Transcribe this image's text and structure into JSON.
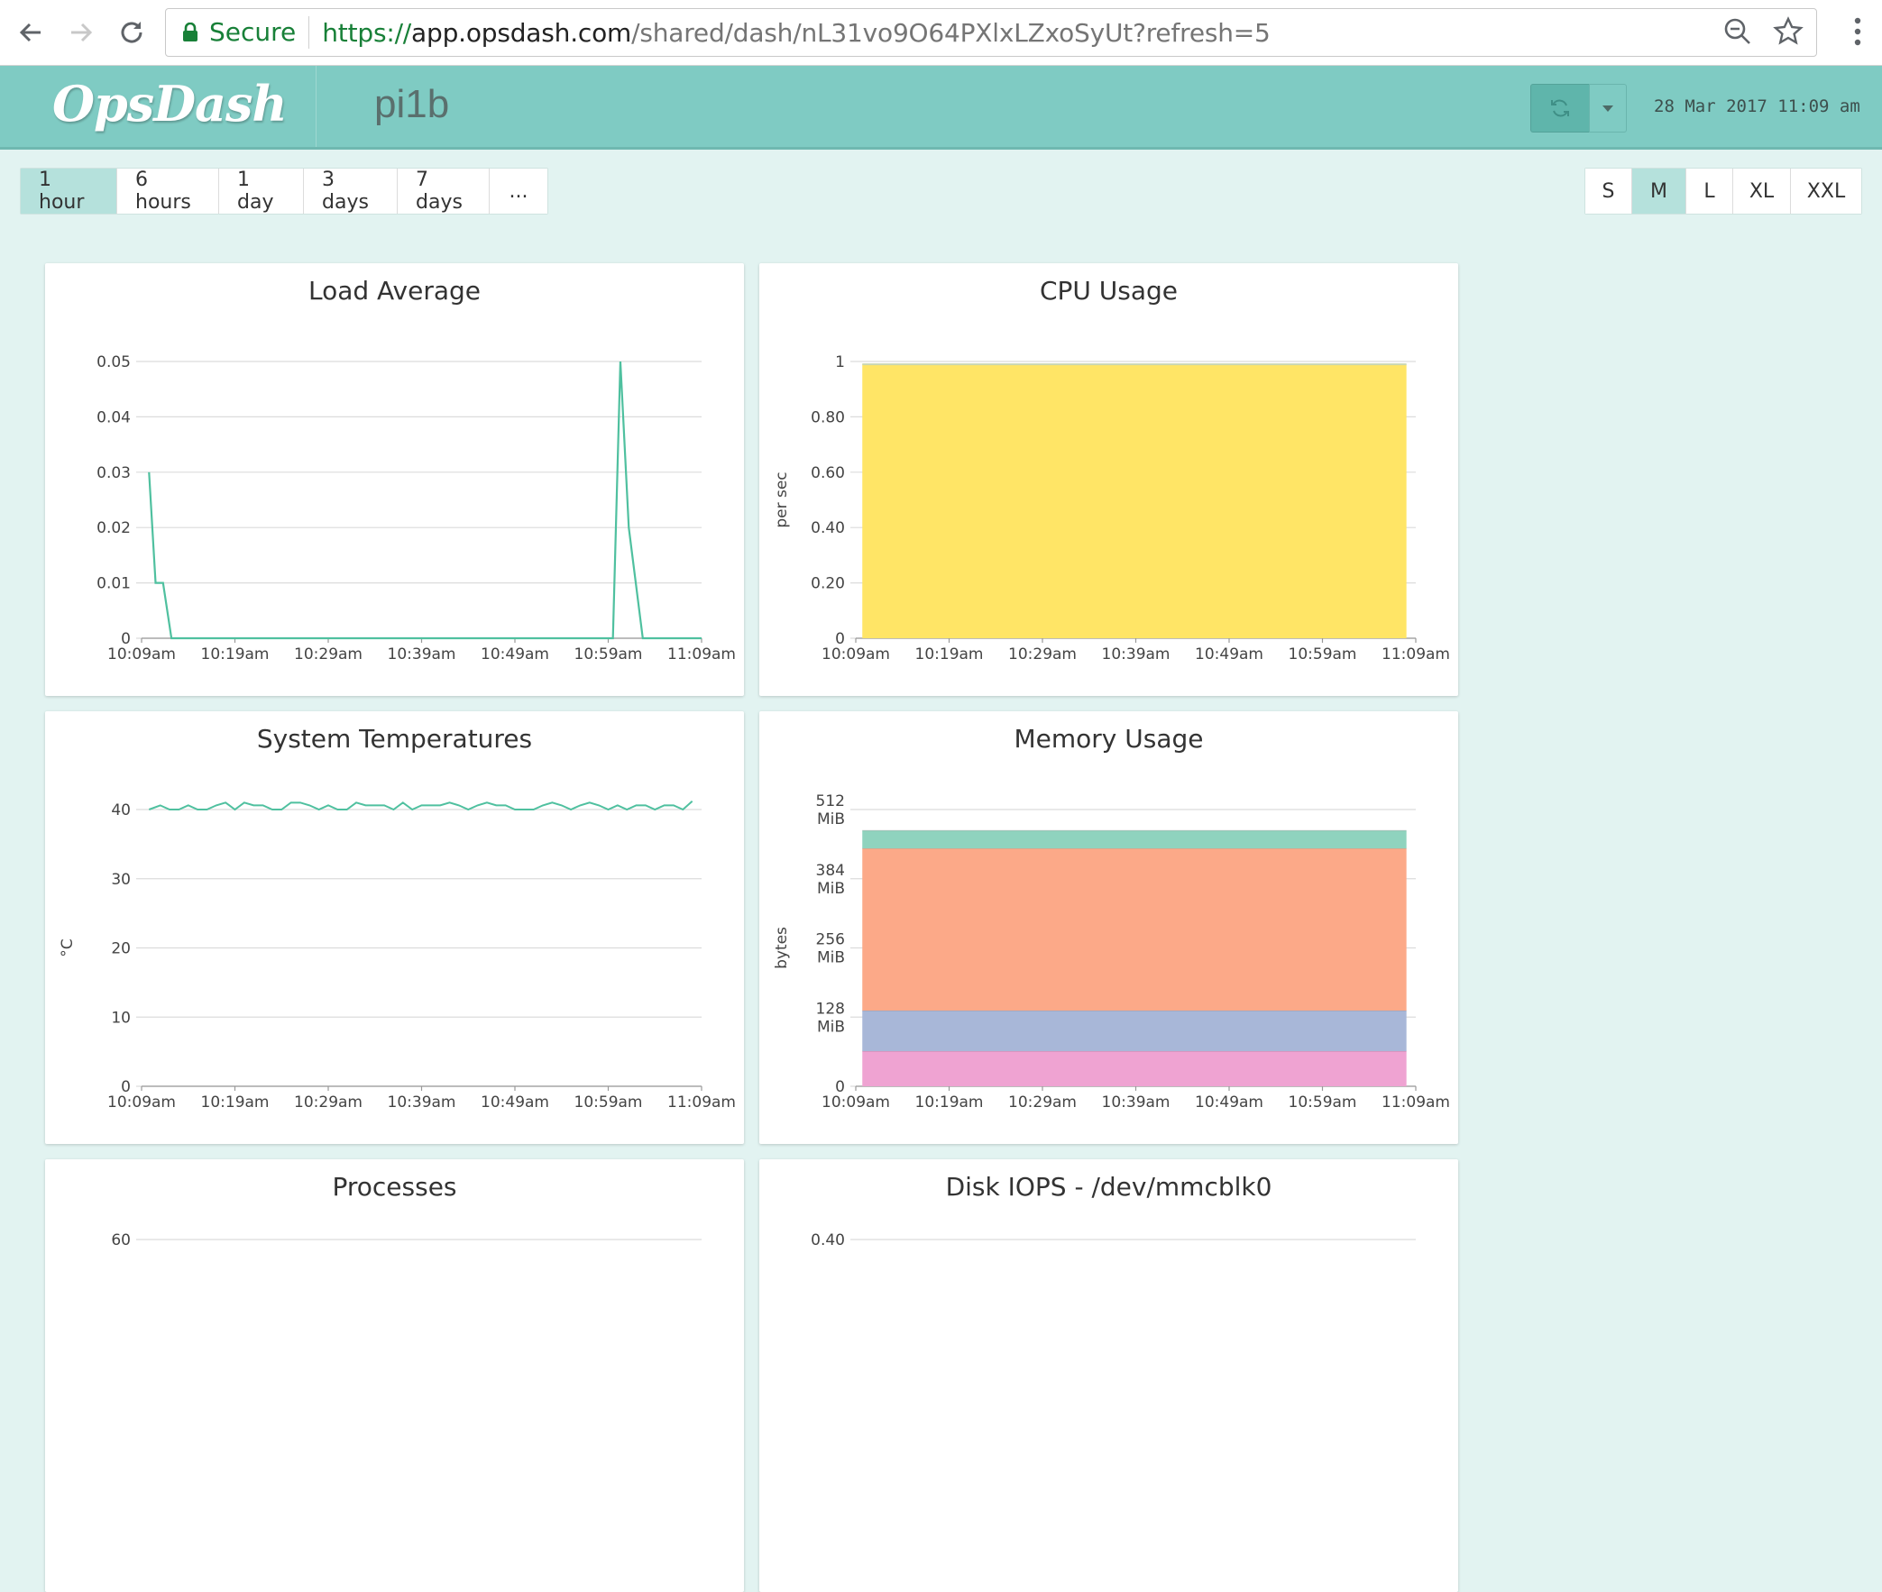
{
  "browser": {
    "secure_label": "Secure",
    "url_scheme": "https://",
    "url_host": "app.opsdash.com",
    "url_path": "/shared/dash/nL31vo9O64PXlxLZxoSyUt?refresh=5"
  },
  "header": {
    "logo": "OpsDash",
    "dashboard_name": "pi1b",
    "timestamp": "28 Mar 2017 11:09 am"
  },
  "time_ranges": [
    {
      "label": "1 hour",
      "active": true
    },
    {
      "label": "6 hours",
      "active": false
    },
    {
      "label": "1 day",
      "active": false
    },
    {
      "label": "3 days",
      "active": false
    },
    {
      "label": "7 days",
      "active": false
    },
    {
      "label": "...",
      "active": false
    }
  ],
  "sizes": [
    {
      "label": "S",
      "active": false
    },
    {
      "label": "M",
      "active": true
    },
    {
      "label": "L",
      "active": false
    },
    {
      "label": "XL",
      "active": false
    },
    {
      "label": "XXL",
      "active": false
    }
  ],
  "panels": {
    "load": {
      "title": "Load Average"
    },
    "cpu": {
      "title": "CPU Usage"
    },
    "temp": {
      "title": "System Temperatures"
    },
    "mem": {
      "title": "Memory Usage"
    },
    "proc": {
      "title": "Processes"
    },
    "disk": {
      "title": "Disk IOPS - /dev/mmcblk0"
    }
  },
  "colors": {
    "accent": "#7fcbc3",
    "line": "#4fc09f",
    "cpu_fill": "#ffe566",
    "mem_top": "#8fd3be",
    "mem_orange": "#fca988",
    "mem_blue": "#a8b7d8",
    "mem_pink": "#efa3d2"
  },
  "chart_data": [
    {
      "type": "line",
      "title": "Load Average",
      "ylabel": "",
      "x_ticks": [
        "10:09am",
        "10:19am",
        "10:29am",
        "10:39am",
        "10:49am",
        "10:59am",
        "11:09am"
      ],
      "xlim": [
        0,
        60
      ],
      "y_ticks": [
        "0",
        "0.01",
        "0.02",
        "0.03",
        "0.04",
        "0.05"
      ],
      "ylim": [
        0,
        0.05
      ],
      "series": [
        {
          "x": [
            0.8,
            1.5,
            2.3,
            3.2,
            50.5,
            51.3,
            52.2,
            53.7,
            60
          ],
          "y": [
            0.03,
            0.01,
            0.01,
            0,
            0,
            0.05,
            0.02,
            0,
            0
          ]
        }
      ]
    },
    {
      "type": "area",
      "title": "CPU Usage",
      "ylabel": "per sec",
      "x_ticks": [
        "10:09am",
        "10:19am",
        "10:29am",
        "10:39am",
        "10:49am",
        "10:59am",
        "11:09am"
      ],
      "xlim": [
        0,
        60
      ],
      "y_ticks": [
        "0",
        "0.20",
        "0.40",
        "0.60",
        "0.80",
        "1"
      ],
      "ylim": [
        0,
        1
      ],
      "series": [
        {
          "x": [
            0.7,
            59
          ],
          "y": [
            0.99,
            0.99
          ]
        }
      ]
    },
    {
      "type": "line",
      "title": "System Temperatures",
      "ylabel": "°C",
      "x_ticks": [
        "10:09am",
        "10:19am",
        "10:29am",
        "10:39am",
        "10:49am",
        "10:59am",
        "11:09am"
      ],
      "xlim": [
        0,
        60
      ],
      "y_ticks": [
        "0",
        "10",
        "20",
        "30",
        "40"
      ],
      "ylim": [
        0,
        40
      ],
      "series": [
        {
          "x": [
            0.8,
            2,
            3,
            4,
            5,
            6,
            7,
            8,
            9,
            10,
            11,
            12,
            13,
            14,
            15,
            16,
            17,
            18,
            19,
            20,
            21,
            22,
            23,
            24,
            25,
            26,
            27,
            28,
            29,
            30,
            31,
            32,
            33,
            34,
            35,
            36,
            37,
            38,
            39,
            40,
            41,
            42,
            43,
            44,
            45,
            46,
            47,
            48,
            49,
            50,
            51,
            52,
            53,
            54,
            55,
            56,
            57,
            58,
            59
          ],
          "y": [
            40,
            40.6,
            40,
            40,
            40.6,
            40,
            40,
            40.6,
            41,
            40,
            41,
            40.6,
            40.6,
            40,
            40,
            41,
            41,
            40.6,
            40,
            40.6,
            40,
            40,
            41,
            40.6,
            40.6,
            40.6,
            40,
            41,
            40,
            40.6,
            40.6,
            40.6,
            41,
            40.6,
            40,
            40.6,
            41,
            40.6,
            40.6,
            40,
            40,
            40,
            40.6,
            41,
            40.6,
            40,
            40.6,
            41,
            40.6,
            40,
            40.6,
            40,
            40.6,
            40.6,
            40,
            40.6,
            40.6,
            40,
            41.2
          ]
        }
      ]
    },
    {
      "type": "area",
      "title": "Memory Usage",
      "ylabel": "bytes",
      "x_ticks": [
        "10:09am",
        "10:19am",
        "10:29am",
        "10:39am",
        "10:49am",
        "10:59am",
        "11:09am"
      ],
      "xlim": [
        0,
        60
      ],
      "y_ticks": [
        "0",
        "128 MiB",
        "256 MiB",
        "384 MiB",
        "512 MiB"
      ],
      "ylim": [
        0,
        512
      ],
      "series": [
        {
          "name": "",
          "color": "#efa3d2",
          "base": 0,
          "top": 65
        },
        {
          "name": "",
          "color": "#a8b7d8",
          "base": 65,
          "top": 140
        },
        {
          "name": "",
          "color": "#fca988",
          "base": 140,
          "top": 440
        },
        {
          "name": "",
          "color": "#8fd3be",
          "base": 440,
          "top": 473
        }
      ]
    },
    {
      "type": "line",
      "title": "Processes",
      "y_ticks": [
        "60"
      ],
      "series": []
    },
    {
      "type": "line",
      "title": "Disk IOPS - /dev/mmcblk0",
      "y_ticks": [
        "0.40"
      ],
      "series": []
    }
  ]
}
